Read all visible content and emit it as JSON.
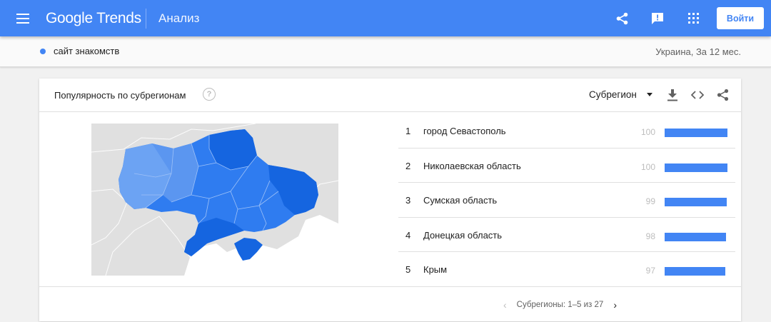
{
  "header": {
    "logo": "Google Trends",
    "title": "Анализ",
    "login_label": "Войти",
    "icons": [
      "menu-icon",
      "share-icon",
      "feedback-icon",
      "apps-icon"
    ]
  },
  "query": {
    "term": "сайт знакомств",
    "term_color": "#4285f4",
    "filters": "Украина, За 12 мес."
  },
  "card": {
    "title": "Популярность по субрегионам",
    "help_glyph": "?",
    "resolution": "Субрегион",
    "header_icons": [
      "download-icon",
      "embed-icon",
      "share-icon"
    ],
    "rows": [
      {
        "rank": "1",
        "name": "город Севастополь",
        "value": "100",
        "level": 100
      },
      {
        "rank": "2",
        "name": "Николаевская область",
        "value": "100",
        "level": 100
      },
      {
        "rank": "3",
        "name": "Сумская область",
        "value": "99",
        "level": 99
      },
      {
        "rank": "4",
        "name": "Донецкая область",
        "value": "98",
        "level": 98
      },
      {
        "rank": "5",
        "name": "Крым",
        "value": "97",
        "level": 97
      }
    ],
    "pager": "Субрегионы: 1–5 из 27"
  },
  "colors": {
    "brand": "#4285f4",
    "map_dark": "#1565e0",
    "map_mid": "#2f7cf0",
    "map_light": "#6ca3f3"
  }
}
